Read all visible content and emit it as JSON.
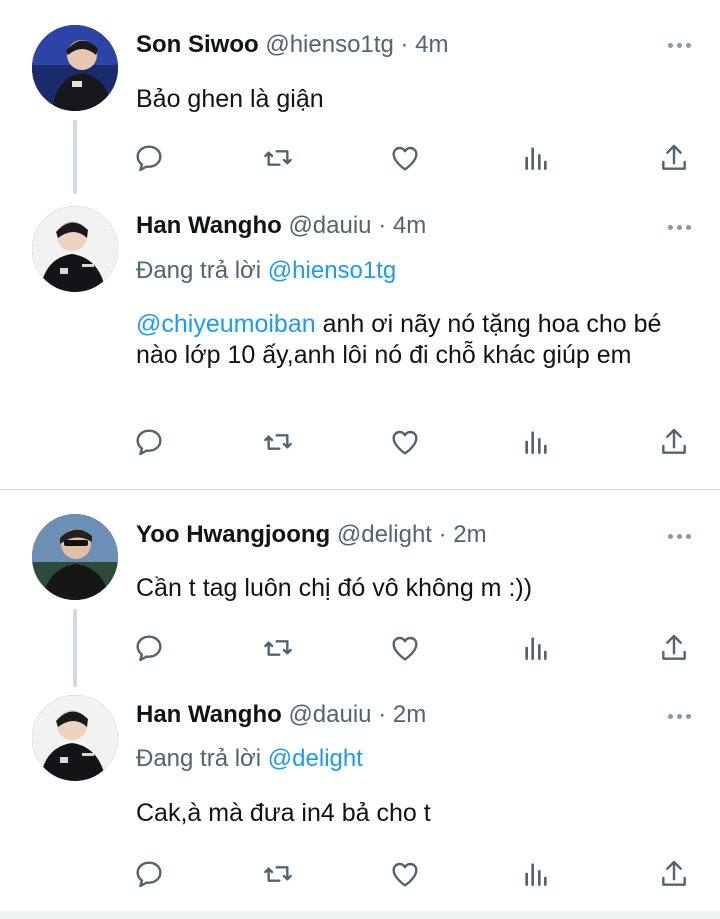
{
  "colors": {
    "link": "#1d9bf0",
    "secondary": "#536471",
    "divider": "#cfd9de"
  },
  "icons": [
    "reply-icon",
    "retweet-icon",
    "like-icon",
    "analytics-icon",
    "share-icon",
    "more-icon"
  ],
  "thread1": {
    "tweet1": {
      "name": "Son Siwoo",
      "handle": "@hienso1tg",
      "time": "4m",
      "sep": " · ",
      "body": "Bảo ghen là giận"
    },
    "tweet2": {
      "name": "Han Wangho",
      "handle": "@dauiu",
      "time": "4m",
      "sep": " · ",
      "replying_prefix": "Đang trả lời ",
      "replying_to": "@hienso1tg",
      "mention": "@chiyeumoiban",
      "body_rest": " anh ơi nãy nó tặng hoa cho bé nào lớp 10 ấy,anh lôi nó đi chỗ khác giúp em"
    }
  },
  "thread2": {
    "tweet1": {
      "name": "Yoo Hwangjoong",
      "handle": "@delight",
      "time": "2m",
      "sep": " · ",
      "body": "Cần t tag luôn chị đó vô không m :))"
    },
    "tweet2": {
      "name": "Han Wangho",
      "handle": "@dauiu",
      "time": "2m",
      "sep": " · ",
      "replying_prefix": "Đang trả lời ",
      "replying_to": "@delight",
      "body": "Cak,à mà đưa in4 bả cho t"
    }
  }
}
